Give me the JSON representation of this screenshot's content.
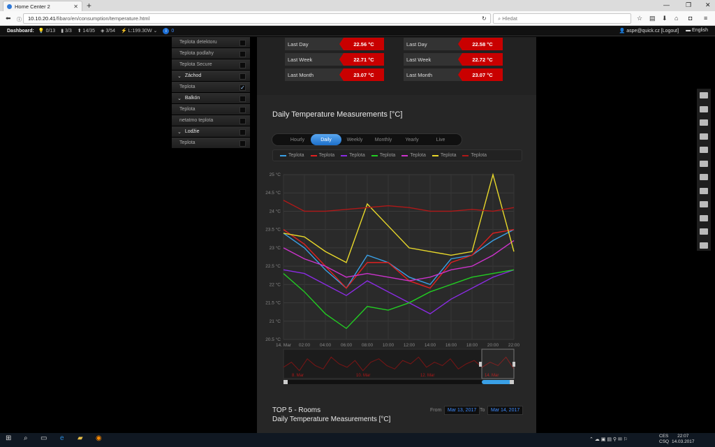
{
  "browser": {
    "tab_title": "Home Center 2",
    "url_host": "10.10.20.41",
    "url_path": "/fibaro/en/consumption/temperature.html",
    "search_placeholder": "Hledat"
  },
  "dashboard": {
    "label": "Dashboard:",
    "items": [
      "0/13",
      "3/3",
      "14/35",
      "3/54",
      "L:199.30W"
    ],
    "notif": "0",
    "user": "aspe@quick.cz [Logout]",
    "language": "English"
  },
  "rooms": [
    {
      "label": "Teplota detektoru",
      "type": "item",
      "checked": false
    },
    {
      "label": "Teplota podlahy",
      "type": "item",
      "checked": false
    },
    {
      "label": "Teplota Secure",
      "type": "item",
      "checked": false
    },
    {
      "label": "Záchod",
      "type": "header",
      "checked": false
    },
    {
      "label": "Teplota",
      "type": "item",
      "checked": true
    },
    {
      "label": "Balkón",
      "type": "header",
      "checked": false
    },
    {
      "label": "Teplota",
      "type": "item",
      "checked": false
    },
    {
      "label": "netatmo teplota",
      "type": "item",
      "checked": false
    },
    {
      "label": "Lodžie",
      "type": "header",
      "checked": false
    },
    {
      "label": "Teplota",
      "type": "item",
      "checked": false
    }
  ],
  "stats_left": [
    {
      "label": "Last Day",
      "value": "22.56 °C"
    },
    {
      "label": "Last Week",
      "value": "22.71 °C"
    },
    {
      "label": "Last Month",
      "value": "23.07 °C"
    }
  ],
  "stats_right": [
    {
      "label": "Last Day",
      "value": "22.58 °C"
    },
    {
      "label": "Last Week",
      "value": "22.72 °C"
    },
    {
      "label": "Last Month",
      "value": "23.07 °C"
    }
  ],
  "chart_title": "Daily Temperature Measurements [°C]",
  "range_tabs": [
    "Hourly",
    "Daily",
    "Weekly",
    "Monthly",
    "Yearly",
    "Live"
  ],
  "active_range": "Daily",
  "chart_data": {
    "type": "line",
    "title": "",
    "xlabel": "",
    "ylabel": "",
    "x": [
      "14. Mar",
      "02:00",
      "04:00",
      "06:00",
      "08:00",
      "10:00",
      "12:00",
      "14:00",
      "16:00",
      "18:00",
      "20:00",
      "22:00"
    ],
    "y_ticks": [
      "25 °C",
      "24.5 °C",
      "24 °C",
      "23.5 °C",
      "23 °C",
      "22.5 °C",
      "22 °C",
      "21.5 °C",
      "21 °C",
      "20.5 °C"
    ],
    "ylim": [
      20.5,
      25
    ],
    "legend_placement": "top",
    "grid": true,
    "series": [
      {
        "name": "Teplota",
        "color": "#3aa0e6",
        "values": [
          23.4,
          23.0,
          22.4,
          21.9,
          22.8,
          22.6,
          22.2,
          22.0,
          22.7,
          22.8,
          23.2,
          23.5
        ]
      },
      {
        "name": "Teplota",
        "color": "#e02020",
        "values": [
          23.5,
          23.1,
          22.5,
          21.9,
          22.6,
          22.6,
          22.1,
          21.9,
          22.6,
          22.8,
          23.4,
          23.5
        ]
      },
      {
        "name": "Teplota",
        "color": "#8a2be2",
        "values": [
          22.4,
          22.3,
          22.0,
          21.7,
          22.1,
          21.8,
          21.5,
          21.2,
          21.6,
          21.9,
          22.2,
          22.4
        ]
      },
      {
        "name": "Teplota",
        "color": "#22cc22",
        "values": [
          22.3,
          21.8,
          21.2,
          20.8,
          21.4,
          21.3,
          21.5,
          21.8,
          22.0,
          22.2,
          22.3,
          22.4
        ]
      },
      {
        "name": "Teplota",
        "color": "#cc33cc",
        "values": [
          23.0,
          22.7,
          22.5,
          22.2,
          22.3,
          22.2,
          22.1,
          22.2,
          22.4,
          22.5,
          22.8,
          23.2
        ]
      },
      {
        "name": "Teplota",
        "color": "#e8d82a",
        "values": [
          23.4,
          23.3,
          22.9,
          22.6,
          24.2,
          23.6,
          23.0,
          22.9,
          22.8,
          22.9,
          25.0,
          22.9
        ]
      },
      {
        "name": "Teplota",
        "color": "#b01818",
        "values": [
          24.3,
          24.0,
          24.0,
          24.05,
          24.1,
          24.15,
          24.1,
          24.0,
          24.0,
          24.05,
          24.0,
          24.1
        ]
      }
    ]
  },
  "navigator": {
    "labels": [
      "8. Mar",
      "10. Mar",
      "12. Mar",
      "14. Mar"
    ],
    "values": [
      22.3,
      22.6,
      22.1,
      22.8,
      22.4,
      22.2,
      22.9,
      22.5,
      22.3,
      22.7,
      22.1,
      22.6,
      22.8,
      22.4,
      22.2,
      22.7,
      22.5,
      22.9,
      22.3,
      22.6,
      22.4,
      22.8,
      22.2,
      22.5,
      22.7,
      22.3,
      22.6,
      22.4,
      22.9,
      22.2
    ]
  },
  "footer": {
    "title1": "TOP 5 - Rooms",
    "title2": "Daily Temperature Measurements [°C]",
    "from_label": "From",
    "from_value": "Mar 13, 2017",
    "to_label": "To",
    "to_value": "Mar 14, 2017"
  },
  "taskbar": {
    "time": "22:07",
    "date": "14.03.2017",
    "lang1": "CES",
    "lang2": "CSQ"
  }
}
